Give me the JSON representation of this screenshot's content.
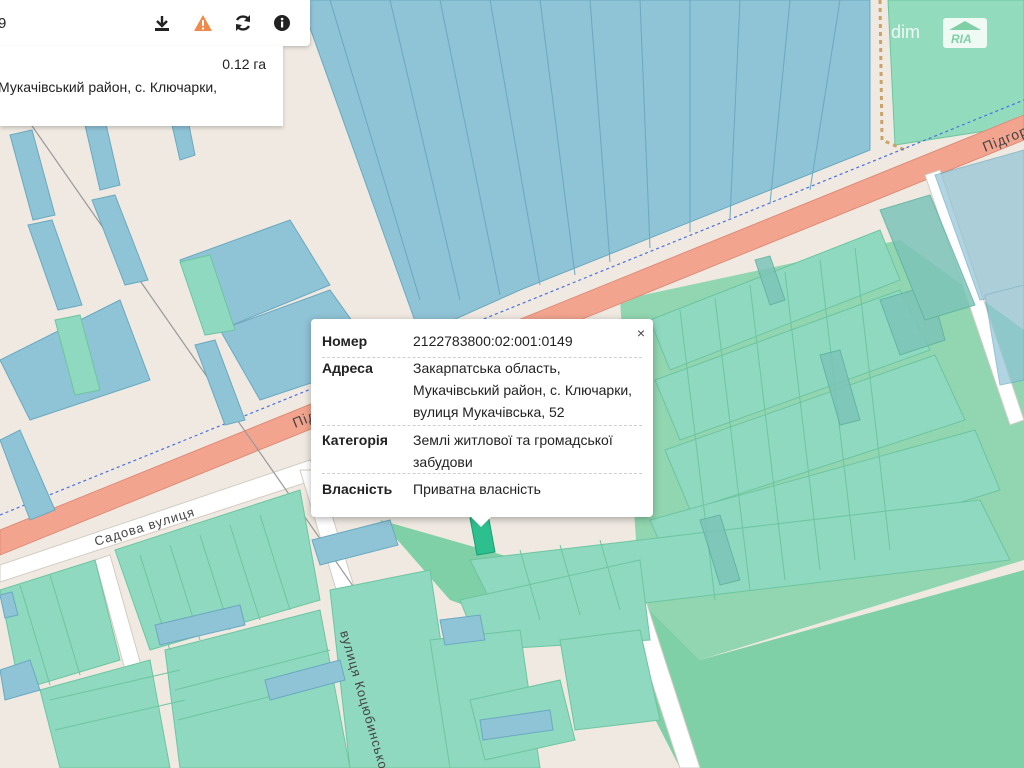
{
  "search": {
    "query_fragment": "9"
  },
  "toolbar": {
    "download_icon": "download-icon",
    "warning_icon": "warning-icon",
    "refresh_icon": "refresh-icon",
    "info_icon": "info-icon",
    "warning_color": "#f08a4b"
  },
  "parcel_info": {
    "area": "0.12 га",
    "address_fragment": "Мукачівський район, с. Ключарки,"
  },
  "popup": {
    "close_label": "×",
    "rows": [
      {
        "label": "Номер",
        "value": "2122783800:02:001:0149"
      },
      {
        "label": "Адреса",
        "value": "Закарпатська область, Мукачівський район, с. Ключарки, вулиця Мукачівська, 52"
      },
      {
        "label": "Категорія",
        "value": "Землі житлової та громадської забудови"
      },
      {
        "label": "Власність",
        "value": "Приватна власність"
      }
    ]
  },
  "map_labels": {
    "road_main_right": "Підгоро",
    "road_main_left": "Під",
    "street_sadova": "Садова вулиця",
    "street_kotsiubynskoho": "вулиця Коцюбинсько"
  },
  "watermark": {
    "left": "dim",
    "right": "RIA"
  },
  "colors": {
    "background": "#efe9e1",
    "parcel_blue": "#8fc3d6",
    "parcel_green": "#8fd9c0",
    "forest": "#7fd0a6",
    "road": "#f2a48e",
    "selected_parcel": "#2ebf8f"
  }
}
